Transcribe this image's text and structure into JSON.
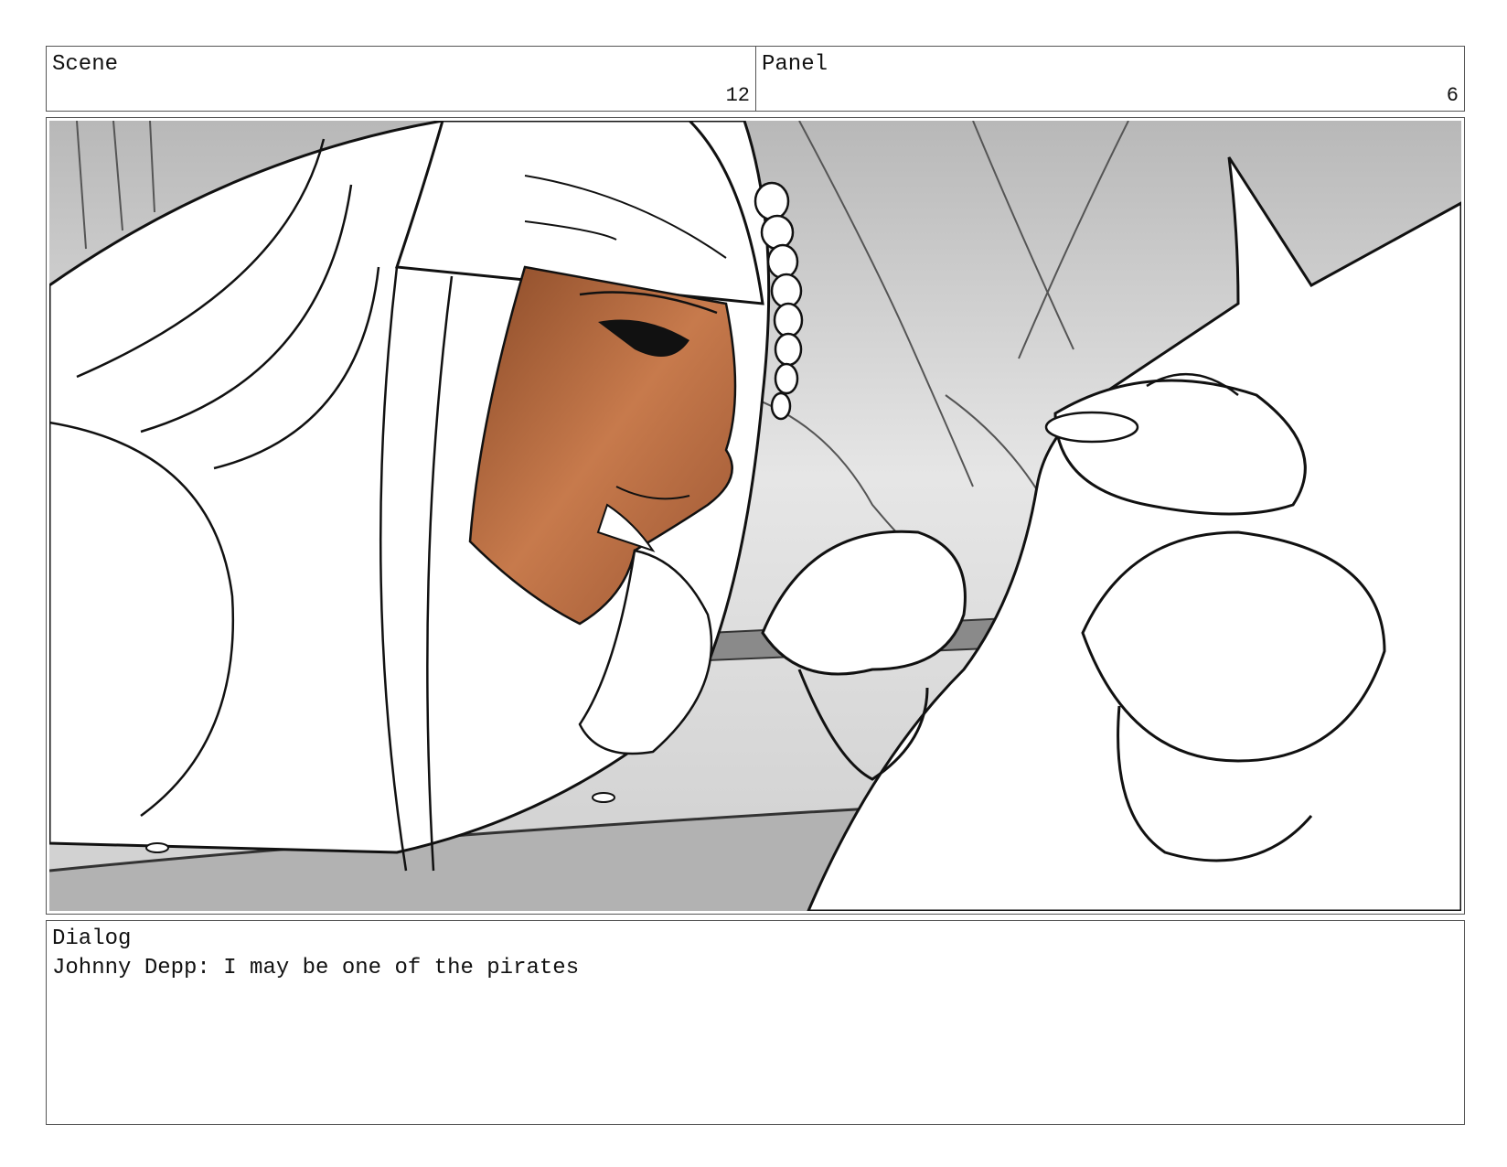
{
  "header": {
    "scene_label": "Scene",
    "scene_number": "12",
    "panel_label": "Panel",
    "panel_number": "6"
  },
  "panel": {
    "illustration": "storyboard sketch: pirate character with bandana and braided beard leaning toward a cartoon cat character"
  },
  "dialog": {
    "label": "Dialog",
    "text": "Johnny Depp: I may be one of the pirates"
  }
}
